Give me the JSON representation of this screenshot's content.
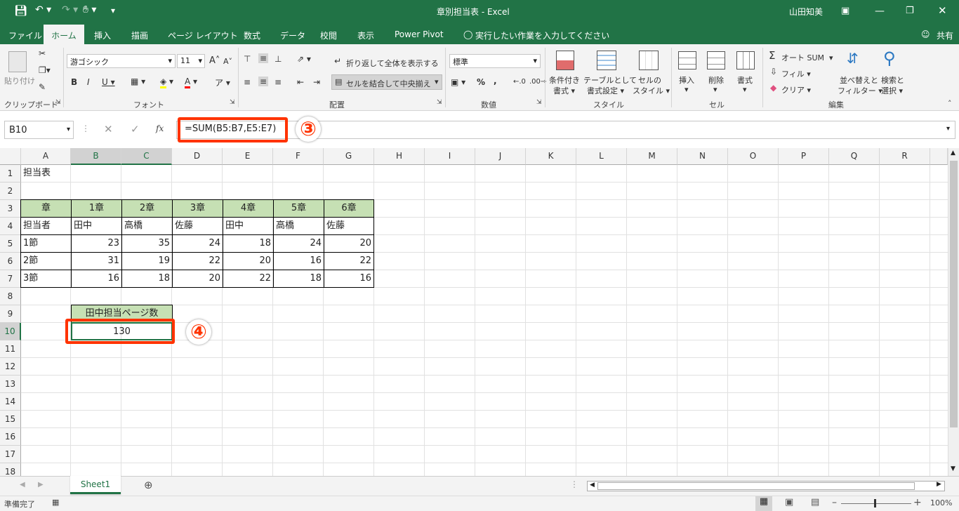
{
  "titlebar": {
    "document_title": "章別担当表 - Excel",
    "user": "山田知美"
  },
  "tabs": [
    "ファイル",
    "ホーム",
    "挿入",
    "描画",
    "ページ レイアウト",
    "数式",
    "データ",
    "校閲",
    "表示",
    "Power Pivot"
  ],
  "tell_me": "実行したい作業を入力してください",
  "share": "共有",
  "ribbon": {
    "clipboard": {
      "paste": "貼り付け",
      "group": "クリップボード"
    },
    "font": {
      "name": "游ゴシック",
      "size": "11",
      "group": "フォント"
    },
    "alignment": {
      "wrap": "折り返して全体を表示する",
      "merge": "セルを結合して中央揃え",
      "group": "配置"
    },
    "number": {
      "format": "標準",
      "group": "数値"
    },
    "styles": {
      "cond1": "条件付き",
      "cond2": "書式",
      "table1": "テーブルとして",
      "table2": "書式設定",
      "cell1": "セルの",
      "cell2": "スタイル",
      "group": "スタイル"
    },
    "cells": {
      "insert": "挿入",
      "delete": "削除",
      "format": "書式",
      "group": "セル"
    },
    "editing": {
      "autosum": "オート SUM",
      "fill": "フィル",
      "clear": "クリア",
      "sort1": "並べ替えと",
      "sort2": "フィルター",
      "find1": "検索と",
      "find2": "選択",
      "group": "編集"
    }
  },
  "formula_bar": {
    "name_box": "B10",
    "fx": "fx",
    "formula": "=SUM(B5:B7,E5:E7)"
  },
  "columns": [
    "A",
    "B",
    "C",
    "D",
    "E",
    "F",
    "G",
    "H",
    "I",
    "J",
    "K",
    "L",
    "M",
    "N",
    "O",
    "P",
    "Q",
    "R"
  ],
  "rows": [
    "1",
    "2",
    "3",
    "4",
    "5",
    "6",
    "7",
    "8",
    "9",
    "10",
    "11",
    "12",
    "13",
    "14",
    "15",
    "16",
    "17",
    "18"
  ],
  "cells": {
    "a1": "担当表",
    "header": [
      "章",
      "1章",
      "2章",
      "3章",
      "4章",
      "5章",
      "6章"
    ],
    "owner": [
      "担当者",
      "田中",
      "高橋",
      "佐藤",
      "田中",
      "高橋",
      "佐藤"
    ],
    "r5": [
      "1節",
      "23",
      "35",
      "24",
      "18",
      "24",
      "20"
    ],
    "r6": [
      "2節",
      "31",
      "19",
      "22",
      "20",
      "16",
      "22"
    ],
    "r7": [
      "3節",
      "16",
      "18",
      "20",
      "22",
      "18",
      "16"
    ],
    "b9": "田中担当ページ数",
    "b10": "130"
  },
  "annotations": {
    "step3": "③",
    "step4": "④"
  },
  "sheet_tab": "Sheet1",
  "status": {
    "ready": "準備完了",
    "zoom": "100%"
  },
  "colors": {
    "excel_green": "#217346",
    "header_fill": "#c6e0b4",
    "annotation_red": "#ff3300"
  }
}
